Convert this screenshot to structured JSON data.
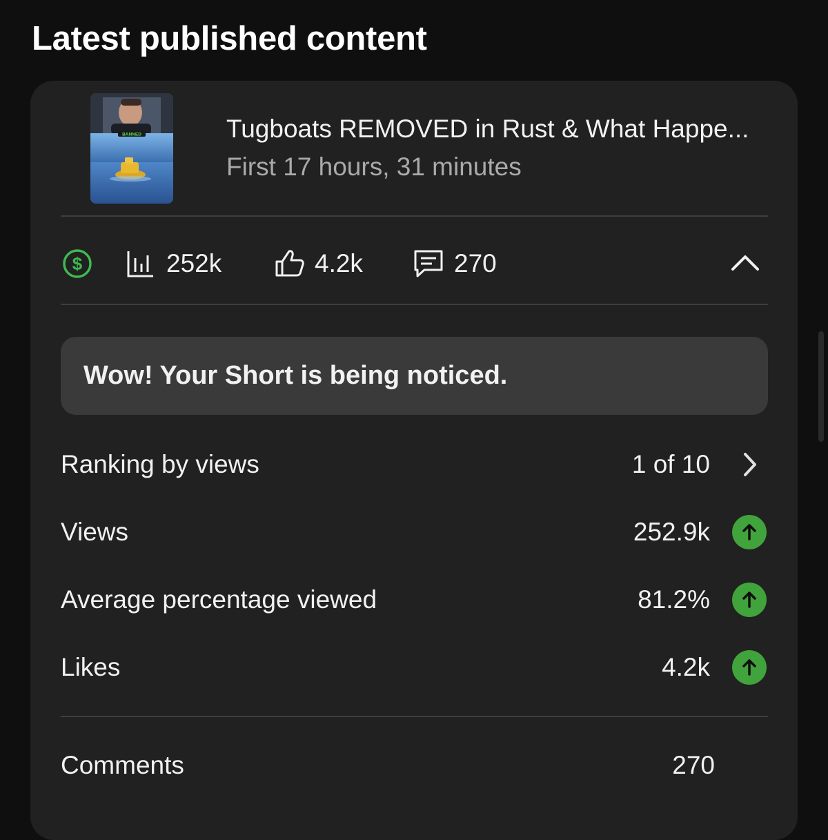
{
  "section_title": "Latest published content",
  "video": {
    "title": "Tugboats REMOVED in Rust & What Happe...",
    "subtitle": "First 17 hours, 31 minutes",
    "thumbnail_text": "BANNED"
  },
  "stats": {
    "views": "252k",
    "likes": "4.2k",
    "comments": "270"
  },
  "banner": "Wow! Your Short is being noticed.",
  "metrics": [
    {
      "label": "Ranking by views",
      "value": "1 of 10"
    },
    {
      "label": "Views",
      "value": "252.9k"
    },
    {
      "label": "Average percentage viewed",
      "value": "81.2%"
    },
    {
      "label": "Likes",
      "value": "4.2k"
    },
    {
      "label": "Comments",
      "value": "270"
    }
  ],
  "colors": {
    "background": "#0f0f0f",
    "card": "#212121",
    "banner": "#3a3a3a",
    "accent_green": "#41a33b",
    "monetization_green": "#3fb950",
    "secondary_text": "#aaaaaa"
  },
  "icons": [
    "monetization-icon",
    "views-chart-icon",
    "like-icon",
    "comment-icon",
    "collapse-chevron-icon",
    "chevron-right-icon",
    "trend-up-icon"
  ]
}
